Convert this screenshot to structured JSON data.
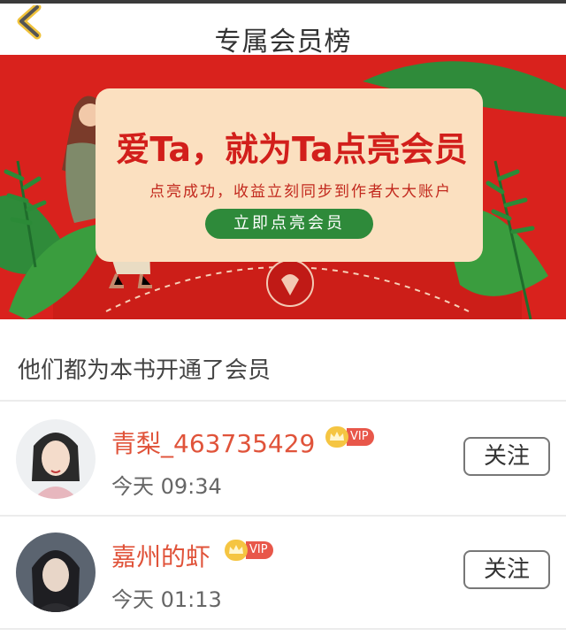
{
  "header": {
    "title": "专属会员榜"
  },
  "banner": {
    "headline": "爱Ta，就为Ta点亮会员",
    "subtitle": "点亮成功，收益立刻同步到作者大大账户",
    "cta_label": "立即点亮会员"
  },
  "section": {
    "title": "他们都为本书开通了会员"
  },
  "members": [
    {
      "name": "青梨_463735429",
      "badge": "VIP",
      "time": "今天 09:34",
      "follow_label": "关注"
    },
    {
      "name": "嘉州的虾",
      "badge": "VIP",
      "time": "今天 01:13",
      "follow_label": "关注"
    }
  ],
  "colors": {
    "accent_red": "#d9221d",
    "name_color": "#e0533a",
    "cta_green": "#2e8a3a",
    "vip_gold": "#f5c542"
  }
}
